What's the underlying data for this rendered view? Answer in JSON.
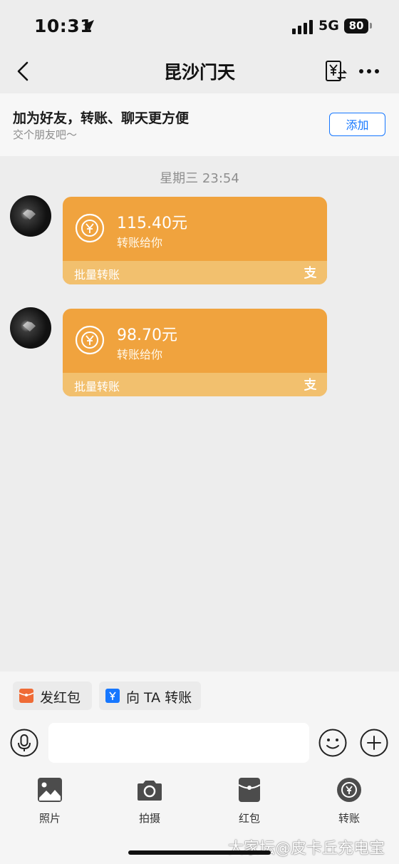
{
  "status_bar": {
    "time": "10:31",
    "network": "5G",
    "battery": "80"
  },
  "nav": {
    "title": "昆沙门天"
  },
  "banner": {
    "title": "加为好友，转账、聊天更方便",
    "subtitle": "交个朋友吧～",
    "add_label": "添加"
  },
  "timestamp": "星期三 23:54",
  "messages": [
    {
      "amount": "115.40元",
      "desc": "转账给你",
      "footer": "批量转账"
    },
    {
      "amount": "98.70元",
      "desc": "转账给你",
      "footer": "批量转账"
    }
  ],
  "quick_actions": [
    {
      "label": "发红包",
      "icon": "red-packet-icon"
    },
    {
      "label": "向 TA 转账",
      "icon": "transfer-icon"
    }
  ],
  "input": {
    "placeholder": ""
  },
  "tools": [
    {
      "label": "照片",
      "icon": "photo-icon"
    },
    {
      "label": "拍摄",
      "icon": "camera-icon"
    },
    {
      "label": "红包",
      "icon": "red-packet-icon"
    },
    {
      "label": "转账",
      "icon": "transfer-icon"
    }
  ],
  "watermark": "大家坛@皮卡丘充电宝",
  "colors": {
    "card": "#f0a33e",
    "card_footer": "#f2c06e",
    "accent": "#1677ff",
    "background": "#ededed"
  }
}
